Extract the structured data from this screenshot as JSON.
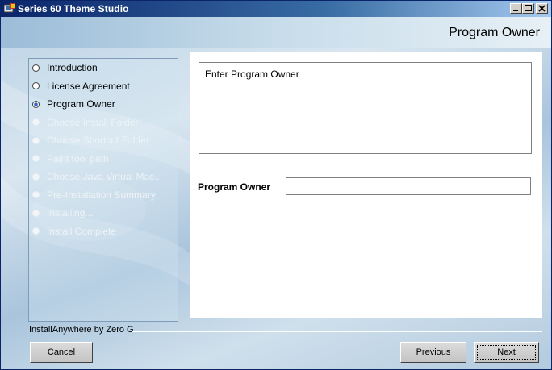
{
  "window": {
    "title": "Series 60 Theme Studio"
  },
  "header": {
    "title": "Program Owner"
  },
  "steps": [
    {
      "label": "Introduction",
      "state": "done"
    },
    {
      "label": "License Agreement",
      "state": "done"
    },
    {
      "label": "Program Owner",
      "state": "current"
    },
    {
      "label": "Choose Install Folder",
      "state": "pending"
    },
    {
      "label": "Choose Shortcut Folder",
      "state": "pending"
    },
    {
      "label": "Paint tool path",
      "state": "pending"
    },
    {
      "label": "Choose Java Virtual Mac...",
      "state": "pending"
    },
    {
      "label": "Pre-Installation Summary",
      "state": "pending"
    },
    {
      "label": "Installing...",
      "state": "pending"
    },
    {
      "label": "Install Complete",
      "state": "pending"
    }
  ],
  "main": {
    "description": "Enter Program Owner",
    "field_label": "Program Owner",
    "field_value": ""
  },
  "footer": {
    "vendor": "InstallAnywhere by Zero G",
    "cancel_label": "Cancel",
    "previous_label": "Previous",
    "next_label": "Next"
  },
  "colors": {
    "title_bar": "#0a246a",
    "window_bg": "#d4d0c8",
    "panel_border": "#808080"
  }
}
